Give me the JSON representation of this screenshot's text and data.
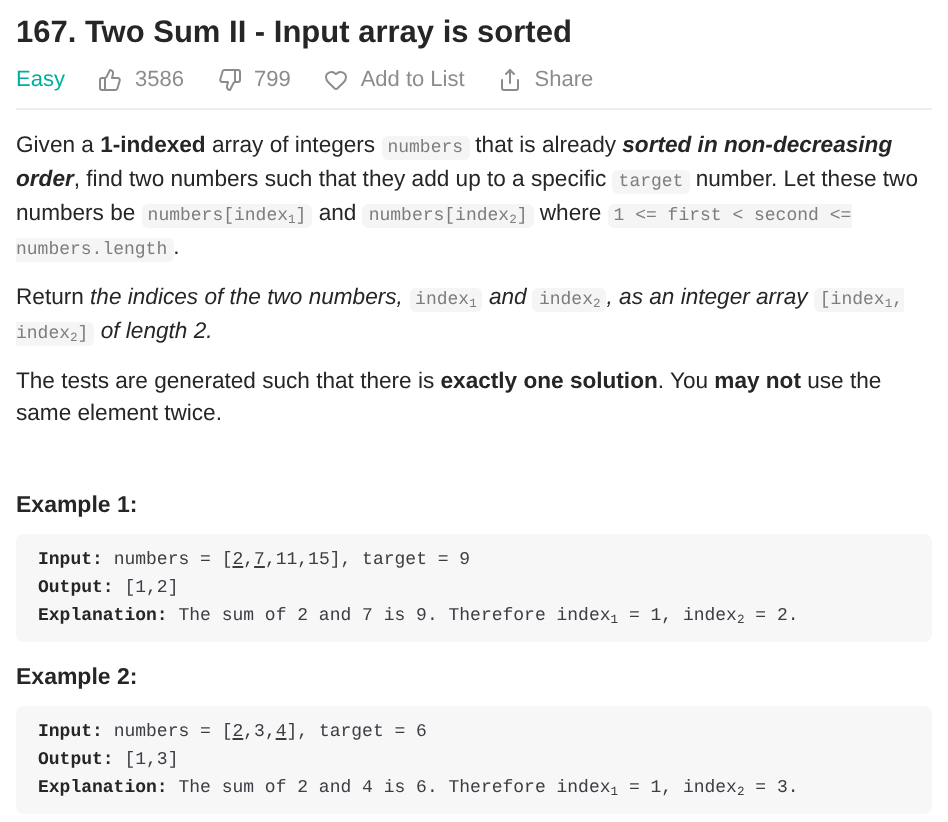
{
  "problem": {
    "title": "167. Two Sum II - Input array is sorted",
    "difficulty": "Easy",
    "likes": "3586",
    "dislikes": "799",
    "actions": [
      {
        "kind": "list",
        "label": "Add to List"
      },
      {
        "kind": "share",
        "label": "Share"
      }
    ]
  },
  "description": [
    {
      "segments": [
        {
          "kind": "text",
          "text": "Given a **1-indexed** array of integers "
        },
        {
          "kind": "code",
          "text": "numbers"
        },
        {
          "kind": "text",
          "text": " that is already "
        },
        {
          "kind": "emphasis",
          "text": "sorted in non-decreasing order"
        },
        {
          "kind": "text",
          "text": ", find two numbers such that they add up to a specific "
        },
        {
          "kind": "code",
          "text": "target"
        },
        {
          "kind": "text",
          "text": " number. Let these two numbers be "
        },
        {
          "kind": "code",
          "text": "numbers[index$_{1}$]"
        },
        {
          "kind": "text",
          "text": " and "
        },
        {
          "kind": "code",
          "text": "numbers[index$_{2}$]"
        },
        {
          "kind": "text",
          "text": " where "
        },
        {
          "kind": "code",
          "text": "1 <= first < second <= numbers.length"
        },
        {
          "kind": "text",
          "text": "."
        }
      ]
    },
    {
      "segments": [
        {
          "kind": "text",
          "text": "Return *the indices of the two numbers,* "
        },
        {
          "kind": "code",
          "text": "index$_{1}$"
        },
        {
          "kind": "text",
          "text": " *and* "
        },
        {
          "kind": "code",
          "text": "index$_{2}$"
        },
        {
          "kind": "text",
          "text": "*, as an integer array* "
        },
        {
          "kind": "code",
          "text": "[index$_{1}$, index$_{2}$]"
        },
        {
          "kind": "text",
          "text": " *of length 2.*"
        }
      ]
    },
    {
      "segments": [
        {
          "kind": "text",
          "text": "The tests are generated such that there is **exactly one solution**. You **may not** use the same element twice."
        }
      ]
    }
  ],
  "examples": [
    {
      "heading": "Example 1:",
      "lines": [
        {
          "label": "Input:",
          "parts": [
            {
              "text": "numbers = [",
              "underlined": false
            },
            {
              "text": "2",
              "underlined": true
            },
            {
              "text": ",",
              "underlined": false
            },
            {
              "text": "7",
              "underlined": true
            },
            {
              "text": ",11,15], target = 9",
              "underlined": false
            }
          ]
        },
        {
          "label": "Output:",
          "parts": [
            {
              "text": "[1,2]",
              "underlined": false
            }
          ]
        },
        {
          "label": "Explanation:",
          "parts": [
            {
              "text": "The sum of 2 and 7 is 9. Therefore index$_{1}$ = 1, index$_{2}$ = 2.",
              "underlined": false
            }
          ]
        }
      ]
    },
    {
      "heading": "Example 2:",
      "lines": [
        {
          "label": "Input:",
          "parts": [
            {
              "text": "numbers = [",
              "underlined": false
            },
            {
              "text": "2",
              "underlined": true
            },
            {
              "text": ",3,",
              "underlined": false
            },
            {
              "text": "4",
              "underlined": true
            },
            {
              "text": "], target = 6",
              "underlined": false
            }
          ]
        },
        {
          "label": "Output:",
          "parts": [
            {
              "text": "[1,3]",
              "underlined": false
            }
          ]
        },
        {
          "label": "Explanation:",
          "parts": [
            {
              "text": "The sum of 2 and 4 is 6. Therefore index$_{1}$ = 1, index$_{2}$ = 3.",
              "underlined": false
            }
          ]
        }
      ]
    }
  ]
}
